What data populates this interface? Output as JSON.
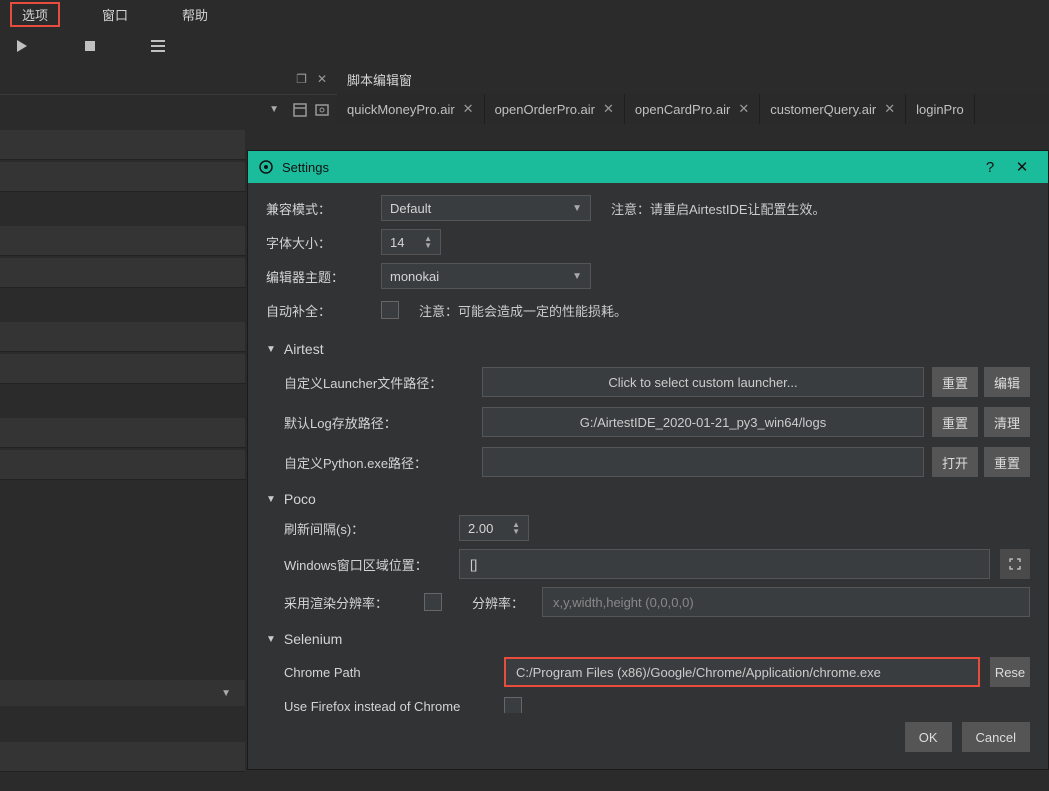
{
  "menubar": {
    "options": "选项",
    "window": "窗口",
    "help": "帮助"
  },
  "script_editor_label": "脚本编辑窗",
  "file_tabs": [
    {
      "name": "quickMoneyPro.air"
    },
    {
      "name": "openOrderPro.air"
    },
    {
      "name": "openCardPro.air"
    },
    {
      "name": "customerQuery.air"
    },
    {
      "name": "loginPro"
    }
  ],
  "dialog": {
    "title": "Settings",
    "help": "?",
    "close": "✕",
    "compat_mode_label": "兼容模式：",
    "compat_mode_value": "Default",
    "compat_note": "注意：请重启AirtestIDE让配置生效。",
    "font_size_label": "字体大小：",
    "font_size_value": "14",
    "theme_label": "编辑器主题：",
    "theme_value": "monokai",
    "autocomplete_label": "自动补全：",
    "autocomplete_note": "注意：可能会造成一定的性能损耗。",
    "section_airtest": "Airtest",
    "launcher_label": "自定义Launcher文件路径：",
    "launcher_value": "Click to select custom launcher...",
    "launcher_reset": "重置",
    "launcher_edit": "编辑",
    "log_label": "默认Log存放路径：",
    "log_value": "G:/AirtestIDE_2020-01-21_py3_win64/logs",
    "log_reset": "重置",
    "log_clean": "清理",
    "python_label": "自定义Python.exe路径：",
    "python_open": "打开",
    "python_reset": "重置",
    "section_poco": "Poco",
    "refresh_label": "刷新间隔(s)：",
    "refresh_value": "2.00",
    "windows_area_label": "Windows窗口区域位置：",
    "windows_area_value": "[]",
    "render_res_label": "采用渲染分辨率：",
    "resolution_label": "分辨率：",
    "resolution_placeholder": "x,y,width,height (0,0,0,0)",
    "section_selenium": "Selenium",
    "chrome_label": "Chrome Path",
    "chrome_value": "C:/Program Files (x86)/Google/Chrome/Application/chrome.exe",
    "chrome_reset": "Rese",
    "firefox_label": "Use Firefox instead of Chrome",
    "ok": "OK",
    "cancel": "Cancel"
  }
}
